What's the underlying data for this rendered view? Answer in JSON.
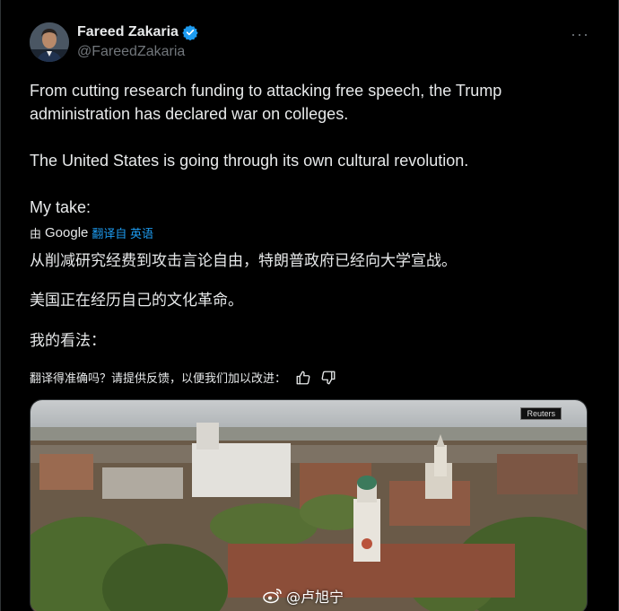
{
  "author": {
    "display_name": "Fareed Zakaria",
    "handle": "@FareedZakaria",
    "verified_color": "#1d9bf0"
  },
  "menu": {
    "more_label": "···"
  },
  "tweet": {
    "paragraphs": [
      "From cutting research funding to attacking free speech, the Trump administration has declared war on colleges.",
      "The United States is going through its own cultural revolution.",
      "My take:"
    ]
  },
  "translation": {
    "by_label": "由",
    "provider": "Google",
    "action_label": "翻译自 英语",
    "paragraphs": [
      "从削减研究经费到攻击言论自由，特朗普政府已经向大学宣战。",
      "美国正在经历自己的文化革命。",
      "我的看法："
    ],
    "feedback_prompt": "翻译得准确吗？请提供反馈，以便我们加以改进："
  },
  "media": {
    "source_badge": "Reuters"
  },
  "watermark": {
    "text": "@卢旭宁"
  }
}
